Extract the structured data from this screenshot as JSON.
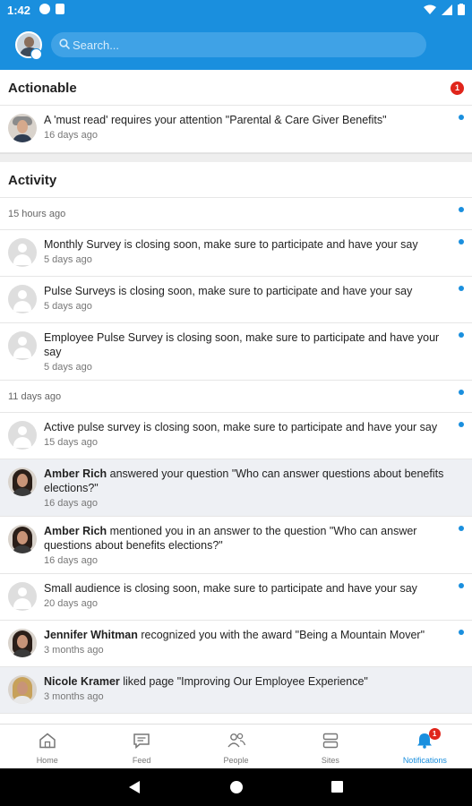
{
  "status_bar": {
    "time": "1:42"
  },
  "search": {
    "placeholder": "Search..."
  },
  "actionable": {
    "title": "Actionable",
    "badge": "1",
    "items": [
      {
        "text": "A 'must read' requires your attention \"Parental & Care Giver Benefits\"",
        "time": "16 days ago"
      }
    ]
  },
  "activity": {
    "title": "Activity",
    "group1": "15 hours ago",
    "group2": "11 days ago",
    "items": [
      {
        "text": "Monthly Survey is closing soon, make sure to participate and have your say",
        "time": "5 days ago"
      },
      {
        "text": "Pulse Surveys is closing soon, make sure to participate and have your say",
        "time": "5 days ago"
      },
      {
        "text": "Employee Pulse Survey is closing soon, make sure to participate and have your say",
        "time": "5 days ago"
      },
      {
        "text": "Active pulse survey is closing soon, make sure to participate and have your say",
        "time": "15 days ago"
      },
      {
        "actor": "Amber Rich",
        "text": " answered your question \"Who can answer questions about benefits elections?\"",
        "time": "16 days ago"
      },
      {
        "actor": "Amber Rich",
        "text": " mentioned you in an answer to the question \"Who can answer questions about benefits elections?\"",
        "time": "16 days ago"
      },
      {
        "text": "Small audience is closing soon, make sure to participate and have your say",
        "time": "20 days ago"
      },
      {
        "actor": "Jennifer Whitman",
        "text": " recognized you with the award \"Being a Mountain Mover\"",
        "time": "3 months ago"
      },
      {
        "actor": "Nicole Kramer",
        "text": " liked page \"Improving Our Employee Experience\"",
        "time": "3 months ago"
      }
    ]
  },
  "tabs": [
    {
      "label": "Home",
      "icon": "home-icon"
    },
    {
      "label": "Feed",
      "icon": "feed-icon"
    },
    {
      "label": "People",
      "icon": "people-icon"
    },
    {
      "label": "Sites",
      "icon": "sites-icon"
    },
    {
      "label": "Notifications",
      "icon": "bell-icon",
      "badge": "1"
    }
  ],
  "colors": {
    "primary": "#1a8fde",
    "badge": "#e0251b",
    "highlight_row": "#eef0f4"
  }
}
